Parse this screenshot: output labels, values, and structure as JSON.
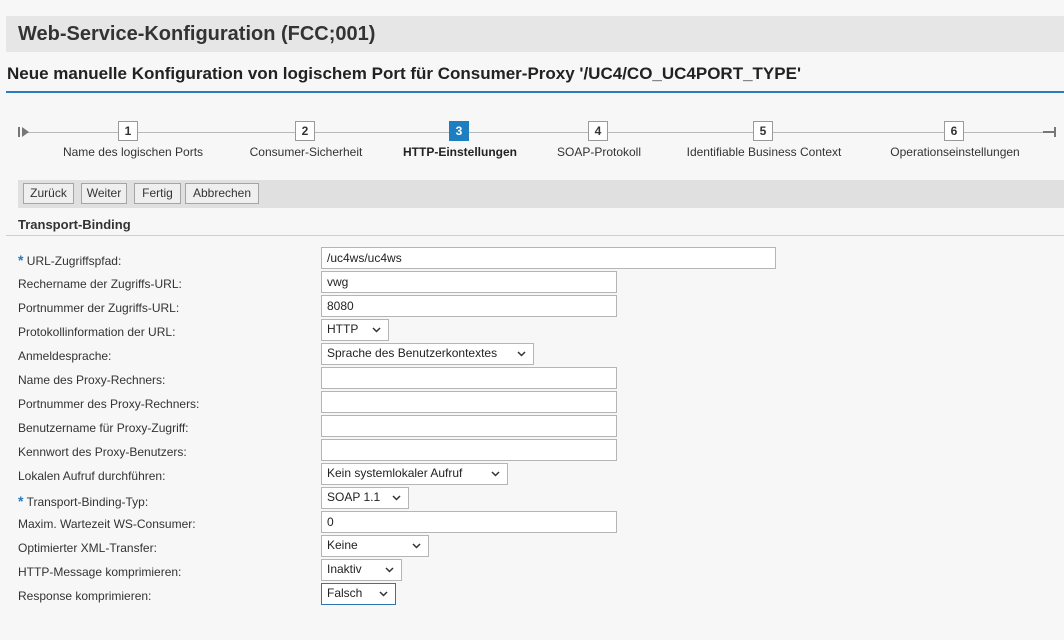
{
  "header": {
    "title": "Web-Service-Konfiguration (FCC;001)",
    "subtitle": "Neue manuelle Konfiguration von logischem Port für Consumer-Proxy '/UC4/CO_UC4PORT_TYPE'"
  },
  "roadmap": {
    "active_step": 3,
    "steps": [
      {
        "num": "1",
        "label": "Name des logischen Ports"
      },
      {
        "num": "2",
        "label": "Consumer-Sicherheit"
      },
      {
        "num": "3",
        "label": "HTTP-Einstellungen"
      },
      {
        "num": "4",
        "label": "SOAP-Protokoll"
      },
      {
        "num": "5",
        "label": "Identifiable Business Context"
      },
      {
        "num": "6",
        "label": "Operationseinstellungen"
      }
    ]
  },
  "toolbar": {
    "back_label": "Zurück",
    "next_label": "Weiter",
    "finish_label": "Fertig",
    "cancel_label": "Abbrechen"
  },
  "section": {
    "title": "Transport-Binding"
  },
  "required_marker": "*",
  "form": {
    "url_path": {
      "label": "URL-Zugriffspfad:",
      "value": "/uc4ws/uc4ws",
      "required": true
    },
    "host": {
      "label": "Rechername der Zugriffs-URL:",
      "value": "vwg"
    },
    "port": {
      "label": "Portnummer der Zugriffs-URL:",
      "value": "8080"
    },
    "protocol": {
      "label": "Protokollinformation der URL:",
      "value": "HTTP"
    },
    "language": {
      "label": "Anmeldesprache:",
      "value": "Sprache des Benutzerkontextes"
    },
    "proxy_host": {
      "label": "Name des Proxy-Rechners:",
      "value": ""
    },
    "proxy_port": {
      "label": "Portnummer des Proxy-Rechners:",
      "value": ""
    },
    "proxy_user": {
      "label": "Benutzername für Proxy-Zugriff:",
      "value": ""
    },
    "proxy_password": {
      "label": "Kennwort des Proxy-Benutzers:",
      "value": ""
    },
    "local_call": {
      "label": "Lokalen Aufruf durchführen:",
      "value": "Kein systemlokaler Aufruf"
    },
    "binding_type": {
      "label": "Transport-Binding-Typ:",
      "value": "SOAP 1.1",
      "required": true
    },
    "max_wait": {
      "label": "Maxim. Wartezeit WS-Consumer:",
      "value": "0"
    },
    "xml_transfer": {
      "label": "Optimierter XML-Transfer:",
      "value": "Keine"
    },
    "http_compress": {
      "label": "HTTP-Message komprimieren:",
      "value": "Inaktiv"
    },
    "response_compress": {
      "label": "Response komprimieren:",
      "value": "Falsch"
    }
  },
  "colors": {
    "accent": "#1d7fc2",
    "required": "#2479c2"
  }
}
